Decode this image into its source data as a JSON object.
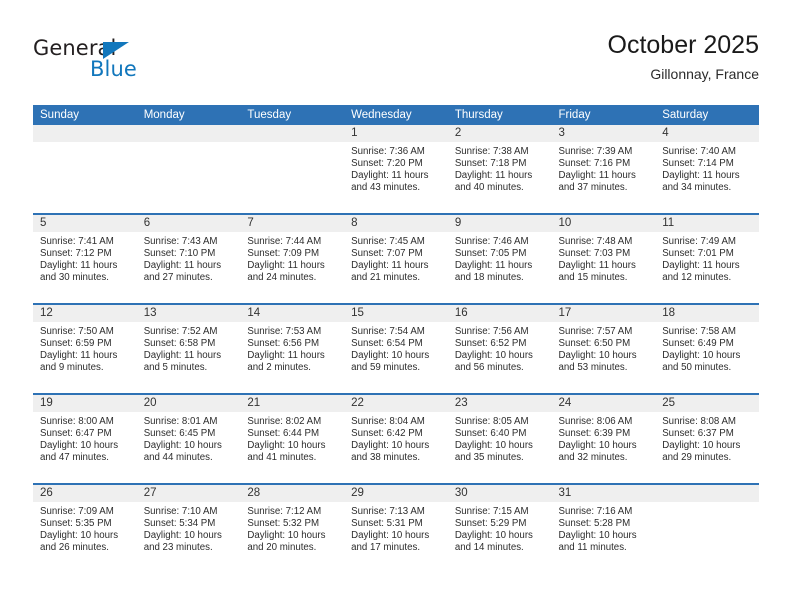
{
  "logo": {
    "word_one": "General",
    "word_two": "Blue",
    "triangle_color": "#1277bc",
    "text_color": "#231f20"
  },
  "header": {
    "title": "October 2025",
    "subtitle": "Gillonnay, France"
  },
  "theme": {
    "header_blue": "#2e72b5",
    "daynum_band": "#efefef",
    "body_text": "#2d2d2d"
  },
  "weekday_headers": [
    "Sunday",
    "Monday",
    "Tuesday",
    "Wednesday",
    "Thursday",
    "Friday",
    "Saturday"
  ],
  "weeks": [
    [
      {
        "day": "",
        "empty": true
      },
      {
        "day": "",
        "empty": true
      },
      {
        "day": "",
        "empty": true
      },
      {
        "day": "1",
        "sunrise": "Sunrise: 7:36 AM",
        "sunset": "Sunset: 7:20 PM",
        "daylight_1": "Daylight: 11 hours",
        "daylight_2": "and 43 minutes."
      },
      {
        "day": "2",
        "sunrise": "Sunrise: 7:38 AM",
        "sunset": "Sunset: 7:18 PM",
        "daylight_1": "Daylight: 11 hours",
        "daylight_2": "and 40 minutes."
      },
      {
        "day": "3",
        "sunrise": "Sunrise: 7:39 AM",
        "sunset": "Sunset: 7:16 PM",
        "daylight_1": "Daylight: 11 hours",
        "daylight_2": "and 37 minutes."
      },
      {
        "day": "4",
        "sunrise": "Sunrise: 7:40 AM",
        "sunset": "Sunset: 7:14 PM",
        "daylight_1": "Daylight: 11 hours",
        "daylight_2": "and 34 minutes."
      }
    ],
    [
      {
        "day": "5",
        "sunrise": "Sunrise: 7:41 AM",
        "sunset": "Sunset: 7:12 PM",
        "daylight_1": "Daylight: 11 hours",
        "daylight_2": "and 30 minutes."
      },
      {
        "day": "6",
        "sunrise": "Sunrise: 7:43 AM",
        "sunset": "Sunset: 7:10 PM",
        "daylight_1": "Daylight: 11 hours",
        "daylight_2": "and 27 minutes."
      },
      {
        "day": "7",
        "sunrise": "Sunrise: 7:44 AM",
        "sunset": "Sunset: 7:09 PM",
        "daylight_1": "Daylight: 11 hours",
        "daylight_2": "and 24 minutes."
      },
      {
        "day": "8",
        "sunrise": "Sunrise: 7:45 AM",
        "sunset": "Sunset: 7:07 PM",
        "daylight_1": "Daylight: 11 hours",
        "daylight_2": "and 21 minutes."
      },
      {
        "day": "9",
        "sunrise": "Sunrise: 7:46 AM",
        "sunset": "Sunset: 7:05 PM",
        "daylight_1": "Daylight: 11 hours",
        "daylight_2": "and 18 minutes."
      },
      {
        "day": "10",
        "sunrise": "Sunrise: 7:48 AM",
        "sunset": "Sunset: 7:03 PM",
        "daylight_1": "Daylight: 11 hours",
        "daylight_2": "and 15 minutes."
      },
      {
        "day": "11",
        "sunrise": "Sunrise: 7:49 AM",
        "sunset": "Sunset: 7:01 PM",
        "daylight_1": "Daylight: 11 hours",
        "daylight_2": "and 12 minutes."
      }
    ],
    [
      {
        "day": "12",
        "sunrise": "Sunrise: 7:50 AM",
        "sunset": "Sunset: 6:59 PM",
        "daylight_1": "Daylight: 11 hours",
        "daylight_2": "and 9 minutes."
      },
      {
        "day": "13",
        "sunrise": "Sunrise: 7:52 AM",
        "sunset": "Sunset: 6:58 PM",
        "daylight_1": "Daylight: 11 hours",
        "daylight_2": "and 5 minutes."
      },
      {
        "day": "14",
        "sunrise": "Sunrise: 7:53 AM",
        "sunset": "Sunset: 6:56 PM",
        "daylight_1": "Daylight: 11 hours",
        "daylight_2": "and 2 minutes."
      },
      {
        "day": "15",
        "sunrise": "Sunrise: 7:54 AM",
        "sunset": "Sunset: 6:54 PM",
        "daylight_1": "Daylight: 10 hours",
        "daylight_2": "and 59 minutes."
      },
      {
        "day": "16",
        "sunrise": "Sunrise: 7:56 AM",
        "sunset": "Sunset: 6:52 PM",
        "daylight_1": "Daylight: 10 hours",
        "daylight_2": "and 56 minutes."
      },
      {
        "day": "17",
        "sunrise": "Sunrise: 7:57 AM",
        "sunset": "Sunset: 6:50 PM",
        "daylight_1": "Daylight: 10 hours",
        "daylight_2": "and 53 minutes."
      },
      {
        "day": "18",
        "sunrise": "Sunrise: 7:58 AM",
        "sunset": "Sunset: 6:49 PM",
        "daylight_1": "Daylight: 10 hours",
        "daylight_2": "and 50 minutes."
      }
    ],
    [
      {
        "day": "19",
        "sunrise": "Sunrise: 8:00 AM",
        "sunset": "Sunset: 6:47 PM",
        "daylight_1": "Daylight: 10 hours",
        "daylight_2": "and 47 minutes."
      },
      {
        "day": "20",
        "sunrise": "Sunrise: 8:01 AM",
        "sunset": "Sunset: 6:45 PM",
        "daylight_1": "Daylight: 10 hours",
        "daylight_2": "and 44 minutes."
      },
      {
        "day": "21",
        "sunrise": "Sunrise: 8:02 AM",
        "sunset": "Sunset: 6:44 PM",
        "daylight_1": "Daylight: 10 hours",
        "daylight_2": "and 41 minutes."
      },
      {
        "day": "22",
        "sunrise": "Sunrise: 8:04 AM",
        "sunset": "Sunset: 6:42 PM",
        "daylight_1": "Daylight: 10 hours",
        "daylight_2": "and 38 minutes."
      },
      {
        "day": "23",
        "sunrise": "Sunrise: 8:05 AM",
        "sunset": "Sunset: 6:40 PM",
        "daylight_1": "Daylight: 10 hours",
        "daylight_2": "and 35 minutes."
      },
      {
        "day": "24",
        "sunrise": "Sunrise: 8:06 AM",
        "sunset": "Sunset: 6:39 PM",
        "daylight_1": "Daylight: 10 hours",
        "daylight_2": "and 32 minutes."
      },
      {
        "day": "25",
        "sunrise": "Sunrise: 8:08 AM",
        "sunset": "Sunset: 6:37 PM",
        "daylight_1": "Daylight: 10 hours",
        "daylight_2": "and 29 minutes."
      }
    ],
    [
      {
        "day": "26",
        "sunrise": "Sunrise: 7:09 AM",
        "sunset": "Sunset: 5:35 PM",
        "daylight_1": "Daylight: 10 hours",
        "daylight_2": "and 26 minutes."
      },
      {
        "day": "27",
        "sunrise": "Sunrise: 7:10 AM",
        "sunset": "Sunset: 5:34 PM",
        "daylight_1": "Daylight: 10 hours",
        "daylight_2": "and 23 minutes."
      },
      {
        "day": "28",
        "sunrise": "Sunrise: 7:12 AM",
        "sunset": "Sunset: 5:32 PM",
        "daylight_1": "Daylight: 10 hours",
        "daylight_2": "and 20 minutes."
      },
      {
        "day": "29",
        "sunrise": "Sunrise: 7:13 AM",
        "sunset": "Sunset: 5:31 PM",
        "daylight_1": "Daylight: 10 hours",
        "daylight_2": "and 17 minutes."
      },
      {
        "day": "30",
        "sunrise": "Sunrise: 7:15 AM",
        "sunset": "Sunset: 5:29 PM",
        "daylight_1": "Daylight: 10 hours",
        "daylight_2": "and 14 minutes."
      },
      {
        "day": "31",
        "sunrise": "Sunrise: 7:16 AM",
        "sunset": "Sunset: 5:28 PM",
        "daylight_1": "Daylight: 10 hours",
        "daylight_2": "and 11 minutes."
      },
      {
        "day": "",
        "empty": true
      }
    ]
  ]
}
